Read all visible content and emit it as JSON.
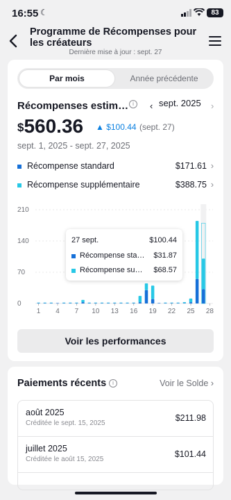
{
  "status_bar": {
    "time": "16:55",
    "battery": "83"
  },
  "header": {
    "title": "Programme de Récompenses pour les créateurs",
    "subtitle": "Dernière mise à jour : sept. 27"
  },
  "tabs": [
    {
      "label": "Par mois",
      "selected": true
    },
    {
      "label": "Année précédente",
      "selected": false
    }
  ],
  "rewards": {
    "label": "Récompenses estim…",
    "month": "sept. 2025",
    "currency": "$",
    "amount": "560.36",
    "delta": "▲ $100.44",
    "delta_date": "(sept. 27)",
    "period": "sept. 1, 2025 - sept. 27, 2025",
    "breakdown": [
      {
        "label": "Récompense standard",
        "value": "$171.61",
        "color": "#1670d8"
      },
      {
        "label": "Récompense supplémentaire",
        "value": "$388.75",
        "color": "#27c8e6"
      }
    ]
  },
  "chart_data": {
    "type": "bar",
    "stacked": true,
    "x": [
      1,
      2,
      3,
      4,
      5,
      6,
      7,
      8,
      9,
      10,
      11,
      12,
      13,
      14,
      15,
      16,
      17,
      18,
      19,
      20,
      21,
      22,
      23,
      24,
      25,
      26,
      27
    ],
    "x_ticks": [
      "1",
      "4",
      "7",
      "10",
      "13",
      "16",
      "19",
      "22",
      "25",
      "28"
    ],
    "y_ticks": [
      "0",
      "70",
      "140",
      "210"
    ],
    "ylim": [
      0,
      210
    ],
    "series": [
      {
        "name": "Récompense standard",
        "color": "#1670d8",
        "values": [
          1,
          1,
          1,
          1,
          1,
          1,
          1,
          3,
          1,
          1,
          1,
          1,
          1,
          1,
          1,
          1,
          3,
          30,
          10,
          1,
          1,
          1,
          1,
          1,
          3,
          55,
          31.87
        ]
      },
      {
        "name": "Récompense supplémentaire",
        "color": "#27c8e6",
        "values": [
          1,
          1,
          1,
          0,
          1,
          1,
          1,
          5,
          1,
          1,
          1,
          1,
          1,
          1,
          1,
          1,
          14,
          15,
          30,
          0,
          1,
          1,
          1,
          2,
          8,
          130,
          68.57
        ]
      }
    ],
    "highlight_index": 26,
    "highlight_outline_values": [
      180,
      178
    ],
    "tooltip": {
      "date": "27 sept.",
      "total": "$100.44",
      "rows": [
        {
          "label": "Récompense standard",
          "value": "$31.87",
          "color": "#1670d8"
        },
        {
          "label": "Récompense supplémentaire",
          "value": "$68.57",
          "color": "#27c8e6"
        }
      ]
    }
  },
  "performance_button": "Voir les performances",
  "payments": {
    "title": "Paiements récents",
    "link": "Voir le Solde",
    "items": [
      {
        "month": "août 2025",
        "sub": "Créditée le sept. 15, 2025",
        "amount": "$211.98"
      },
      {
        "month": "juillet 2025",
        "sub": "Créditée le août 15, 2025",
        "amount": "$101.44"
      }
    ]
  }
}
